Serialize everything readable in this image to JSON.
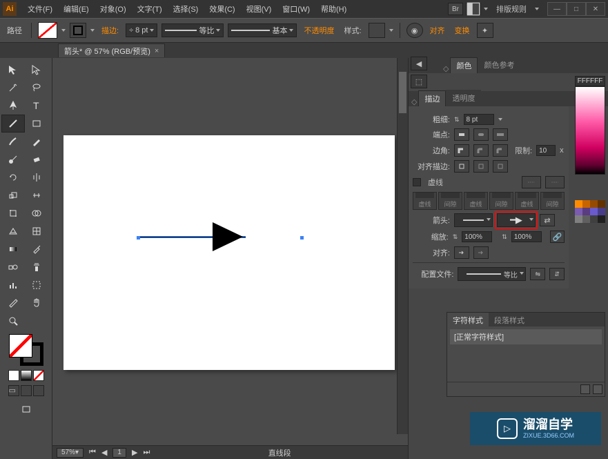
{
  "app": {
    "logo": "Ai"
  },
  "menu": {
    "file": "文件(F)",
    "edit": "编辑(E)",
    "object": "对象(O)",
    "type": "文字(T)",
    "select": "选择(S)",
    "effect": "效果(C)",
    "view": "视图(V)",
    "window": "窗口(W)",
    "help": "帮助(H)"
  },
  "titlebar": {
    "layoutRules": "排版规则",
    "br": "Br"
  },
  "control": {
    "pathLabel": "路径",
    "strokeLabel": "描边:",
    "strokeValue": "8 pt",
    "uniformLabel": "等比",
    "basicLabel": "基本",
    "opacityLabel": "不透明度",
    "styleLabel": "样式:",
    "alignLabel": "对齐",
    "transformLabel": "变换"
  },
  "document": {
    "tabTitle": "箭头* @ 57% (RGB/预览)",
    "tabClose": "×"
  },
  "statusbar": {
    "zoom": "57%",
    "page": "1",
    "info": "直线段"
  },
  "panels": {
    "color": {
      "tab": "颜色",
      "guideTab": "颜色参考",
      "hex": "FFFFFF"
    },
    "stroke": {
      "tab": "描边",
      "opacityTab": "透明度",
      "weightLabel": "粗细:",
      "weightValue": "8 pt",
      "capLabel": "端点:",
      "cornerLabel": "边角:",
      "limitLabel": "限制:",
      "limitValue": "10",
      "limitX": "x",
      "alignStrokeLabel": "对齐描边:",
      "dashLabel": "虚线",
      "dashCols": [
        "虚线",
        "间隙",
        "虚线",
        "间隙",
        "虚线",
        "间隙"
      ],
      "arrowLabel": "箭头:",
      "scaleLabel": "缩放:",
      "scaleValue1": "100%",
      "scaleValue2": "100%",
      "alignLabel": "对齐:",
      "profileLabel": "配置文件:",
      "profileValue": "等比"
    },
    "charStyle": {
      "tab1": "字符样式",
      "tab2": "段落样式",
      "item": "[正常字符样式]"
    }
  },
  "watermark": {
    "brand": "溜溜自学",
    "url": "ZIXUE.3D66.COM"
  }
}
